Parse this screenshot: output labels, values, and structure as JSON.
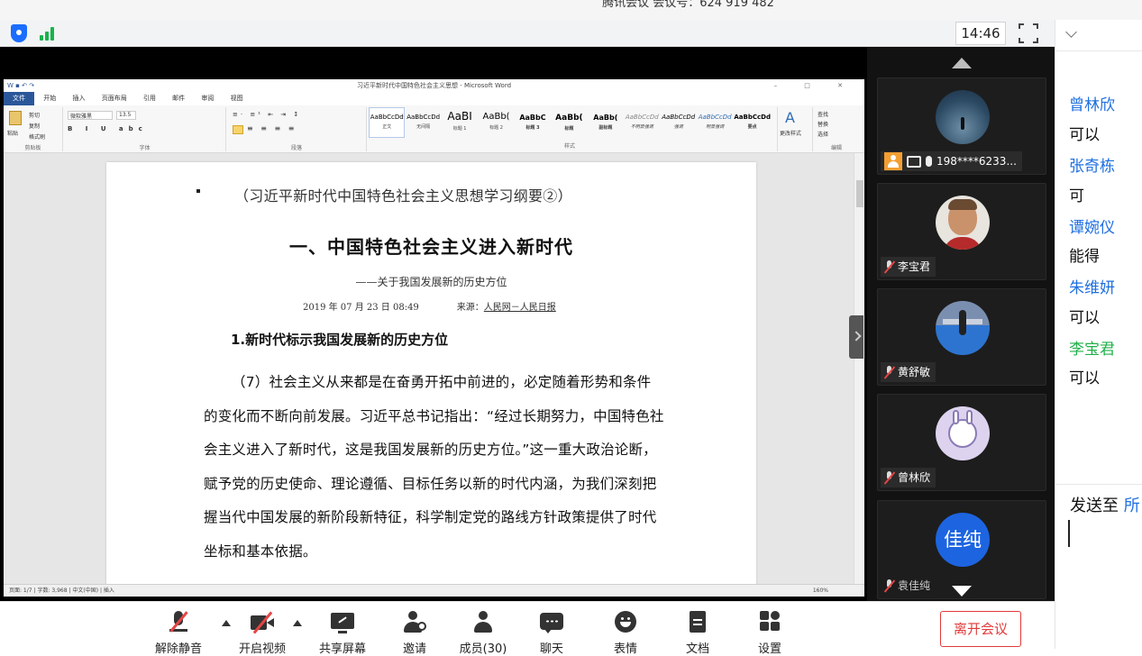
{
  "window": {
    "caption": "腾讯会议 会议号：624 919 482"
  },
  "topbar": {
    "time": "14:46"
  },
  "word": {
    "title": "习近平新时代中国特色社会主义思想 - Microsoft Word",
    "tabs": [
      "文件",
      "开始",
      "插入",
      "页面布局",
      "引用",
      "邮件",
      "审阅",
      "视图"
    ],
    "font_name": "微软雅黑",
    "font_size": "13.5",
    "groups": [
      "剪贴板",
      "字体",
      "段落",
      "样式",
      "编辑"
    ],
    "clipboard": {
      "paste": "粘贴",
      "cut": "剪切",
      "copy": "复制",
      "painter": "格式刷"
    },
    "styles": [
      {
        "sample": "AaBbCcDd",
        "name": "正文"
      },
      {
        "sample": "AaBbCcDd",
        "name": "无间隔"
      },
      {
        "sample": "AaBI",
        "name": "标题 1"
      },
      {
        "sample": "AaBb(",
        "name": "标题 2"
      },
      {
        "sample": "AaBbC",
        "name": "标题 3"
      },
      {
        "sample": "AaBb(",
        "name": "标题"
      },
      {
        "sample": "AaBb(",
        "name": "副标题"
      },
      {
        "sample": "AaBbCcDd",
        "name": "不明显强调"
      },
      {
        "sample": "AaBbCcDd",
        "name": "强调"
      },
      {
        "sample": "AaBbCcDd",
        "name": "明显强调"
      },
      {
        "sample": "AaBbCcDd",
        "name": "要点"
      },
      {
        "sample": "AaBbCcDd",
        "name": "引用"
      }
    ],
    "change_styles": "更改样式",
    "editing": {
      "find": "查找",
      "replace": "替换",
      "select": "选择"
    },
    "status": {
      "page": "页面: 1/7",
      "words": "字数: 3,968",
      "lang": "中文(中国)",
      "mode": "插入",
      "zoom": "160%"
    }
  },
  "doc": {
    "bullet_line": "（习近平新时代中国特色社会主义思想学习纲要②）",
    "heading": "一、中国特色社会主义进入新时代",
    "subtitle": "——关于我国发展新的历史方位",
    "date": "2019 年 07 月 23 日 08:49",
    "source_label": "来源：",
    "source_link": "人民网－人民日报",
    "section": "1.新时代标示我国发展新的历史方位",
    "paragraph": "（7）社会主义从来都是在奋勇开拓中前进的，必定随着形势和条件的变化而不断向前发展。习近平总书记指出：“经过长期努力，中国特色社会主义进入了新时代，这是我国发展新的历史方位。”这一重大政治论断，赋予党的历史使命、理论遵循、目标任务以新的时代内涵，为我们深刻把握当代中国发展的新阶段新特征，科学制定党的路线方针政策提供了时代坐标和基本依据。"
  },
  "participants": [
    {
      "label": "198****6233..."
    },
    {
      "label": "李宝君"
    },
    {
      "label": "黄舒敏"
    },
    {
      "label": "曾林欣"
    },
    {
      "label": "袁佳纯",
      "avatar_text": "佳纯"
    }
  ],
  "chat": {
    "messages": [
      {
        "name": "曾林欣",
        "text": "可以"
      },
      {
        "name": "张奇栋",
        "text": "可"
      },
      {
        "name": "谭婉仪",
        "text": "能得"
      },
      {
        "name": "朱维妍",
        "text": "可以"
      },
      {
        "name": "李宝君",
        "text": "可以"
      }
    ],
    "send_label": "发送至",
    "send_target": "所"
  },
  "toolbar": {
    "unmute": "解除静音",
    "video": "开启视频",
    "share": "共享屏幕",
    "invite": "邀请",
    "members": "成员(30)",
    "chat": "聊天",
    "emoji": "表情",
    "docs": "文档",
    "settings": "设置",
    "leave": "离开会议"
  },
  "colors": {
    "accent": "#1f6fe0",
    "self_name": "#22b04b",
    "danger": "#e23a3a",
    "signal": "#17b34a"
  }
}
